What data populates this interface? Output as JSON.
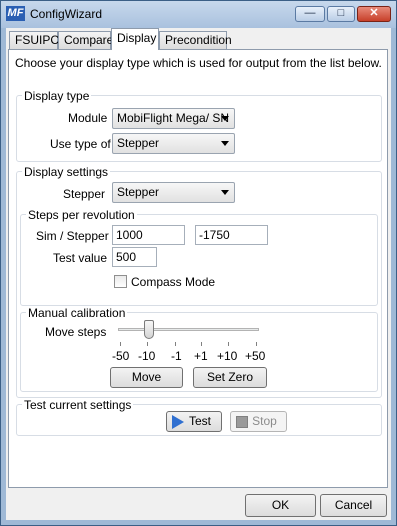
{
  "window": {
    "icon_text": "MF",
    "title": "ConfigWizard"
  },
  "tabs": [
    {
      "label": "FSUIPC"
    },
    {
      "label": "Compare"
    },
    {
      "label": "Display",
      "active": true
    },
    {
      "label": "Precondition"
    }
  ],
  "intro": "Choose your display type which is used for output from the list below.",
  "display_type": {
    "title": "Display type",
    "module_label": "Module",
    "module_value": "MobiFlight Mega/ SN",
    "use_type_label": "Use type of",
    "use_type_value": "Stepper"
  },
  "display_settings": {
    "title": "Display settings",
    "stepper_label": "Stepper",
    "stepper_value": "Stepper"
  },
  "steps_per_revolution": {
    "title": "Steps per revolution",
    "sim_stepper_label": "Sim / Stepper",
    "sim_value": "1000",
    "stepper_value": "-1750",
    "test_value_label": "Test value",
    "test_value": "500",
    "compass_mode_label": "Compass Mode",
    "compass_mode_checked": false
  },
  "manual_calibration": {
    "title": "Manual calibration",
    "move_steps_label": "Move steps",
    "step_labels": [
      "-50",
      "-10",
      "-1",
      "+1",
      "+10",
      "+50"
    ],
    "selected_step": "-10",
    "move_button": "Move",
    "set_zero_button": "Set Zero"
  },
  "test_current_settings": {
    "title": "Test current settings",
    "test_button": "Test",
    "stop_button": "Stop"
  },
  "footer": {
    "ok_button": "OK",
    "cancel_button": "Cancel"
  },
  "icons": [
    "app-logo-icon",
    "minimize-icon",
    "maximize-icon",
    "close-icon",
    "dropdown-arrow-icon",
    "play-icon",
    "stop-icon"
  ]
}
